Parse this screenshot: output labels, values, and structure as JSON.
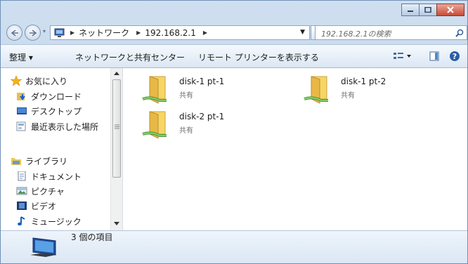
{
  "address": {
    "crumbs": [
      "ネットワーク",
      "192.168.2.1"
    ],
    "search_placeholder": "192.168.2.1の検索"
  },
  "toolbar": {
    "organize": "整理 ▾",
    "network_center": "ネットワークと共有センター",
    "remote_printers": "リモート プリンターを表示する"
  },
  "nav": {
    "favorites": "お気に入り",
    "downloads": "ダウンロード",
    "desktop": "デスクトップ",
    "recent": "最近表示した場所",
    "libraries": "ライブラリ",
    "documents": "ドキュメント",
    "pictures": "ピクチャ",
    "videos": "ビデオ",
    "music": "ミュージック"
  },
  "items": [
    {
      "name": "disk-1 pt-1",
      "type": "共有"
    },
    {
      "name": "disk-1 pt-2",
      "type": "共有"
    },
    {
      "name": "disk-2 pt-1",
      "type": "共有"
    }
  ],
  "status": {
    "count": "3 個の項目"
  },
  "colors": {
    "accent": "#b9cfe6",
    "close": "#c94b35",
    "folder": "#f2cf5b"
  }
}
